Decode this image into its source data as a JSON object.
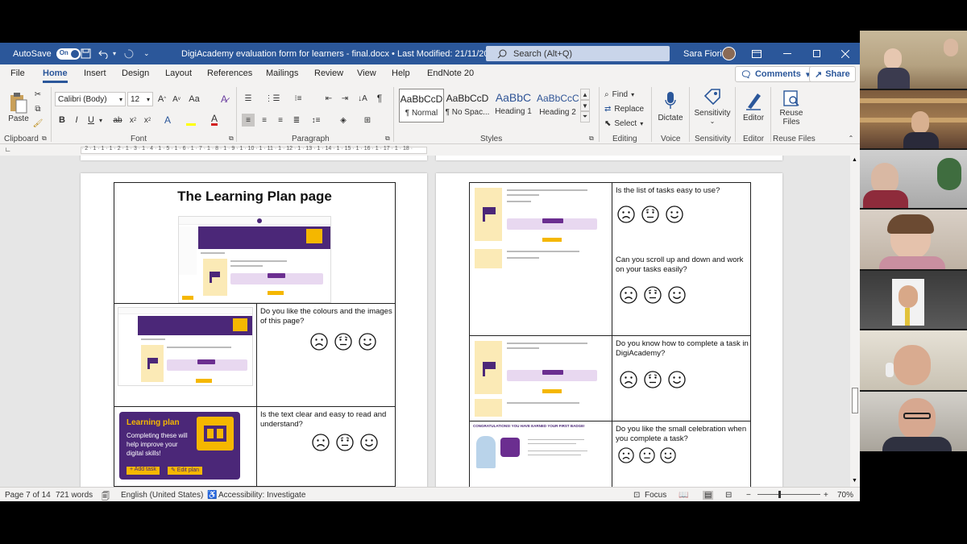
{
  "titlebar": {
    "autosave_label": "AutoSave",
    "autosave_state": "On",
    "doc_title": "DigiAcademy evaluation form for learners - final.docx • Last Modified: 21/11/2022",
    "search_placeholder": "Search (Alt+Q)",
    "user_name": "Sara Fiori",
    "accent_color": "#2b579a"
  },
  "menu": {
    "tabs": [
      "File",
      "Home",
      "Insert",
      "Design",
      "Layout",
      "References",
      "Mailings",
      "Review",
      "View",
      "Help",
      "EndNote 20"
    ],
    "active_tab": "Home",
    "comments_label": "Comments",
    "share_label": "Share"
  },
  "ribbon": {
    "paste_label": "Paste",
    "font_name": "Calibri (Body)",
    "font_size": "12",
    "styles": [
      {
        "preview": "AaBbCcD",
        "name": "¶ Normal"
      },
      {
        "preview": "AaBbCcD",
        "name": "¶ No Spac..."
      },
      {
        "preview": "AaBbC",
        "name": "Heading 1"
      },
      {
        "preview": "AaBbCcC",
        "name": "Heading 2"
      }
    ],
    "find_label": "Find",
    "replace_label": "Replace",
    "select_label": "Select",
    "dictate_label": "Dictate",
    "sensitivity_label": "Sensitivity",
    "editor_label": "Editor",
    "reuse_files_label": "Reuse Files",
    "groups": {
      "clipboard": "Clipboard",
      "font": "Font",
      "paragraph": "Paragraph",
      "styles": "Styles",
      "editing": "Editing",
      "voice": "Voice",
      "sensitivity": "Sensitivity",
      "editor": "Editor",
      "reuse_files": "Reuse Files"
    }
  },
  "ruler": {
    "marks": "· 2 · 1 · 1 · 1 · 2 · 1 · 3 · 1 · 4 · 1 · 5 · 1 · 6 · 1 · 7 · 1 · 8 · 1 · 9 · 1 · 10 · 1 · 11 · 1 · 12 · 1 · 13 · 1 · 14 · 1 · 15 · 1 · 16 · 1 · 17 · 1 · 18 ·"
  },
  "document": {
    "left_page": {
      "heading": "The Learning Plan page",
      "q1": "Do you like the colours and the images of this page?",
      "q2": "Is the text clear and easy to read and understand?",
      "thumb_learning_plan": "Learning plan",
      "thumb_completing_text": "Completing these will help improve your digital skills!",
      "thumb_add_task": "+ Add task",
      "thumb_edit_plan": "✎ Edit plan"
    },
    "right_page": {
      "q1": "Is the list of tasks easy to use?",
      "q2": "Can you scroll up and down and work on your tasks easily?",
      "q3": "Do you know how to complete a task in DigiAcademy?",
      "q4": "Do you like the small celebration when you complete a task?",
      "congrats_banner": "CONGRATULATIONS! YOU HAVE EARNED YOUR FIRST BADGE!"
    }
  },
  "status": {
    "page": "Page 7 of 14",
    "words": "721 words",
    "language": "English (United States)",
    "accessibility": "Accessibility: Investigate",
    "focus": "Focus",
    "zoom": "70%"
  }
}
